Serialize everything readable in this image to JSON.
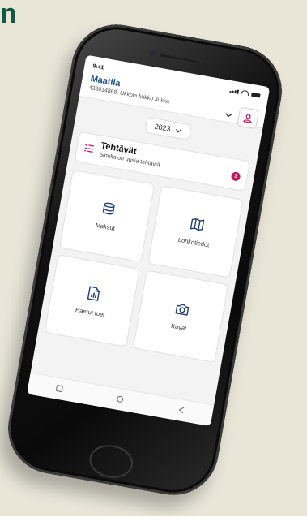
{
  "page_heading_fragment": "n",
  "status_bar": {
    "time": "9:41"
  },
  "header": {
    "title": "Maatila",
    "subtitle": "433014868, Ukkola Mikko Jukka"
  },
  "year_selector": {
    "value": "2023"
  },
  "tasks_card": {
    "title": "Tehtävät",
    "subtitle": "Sinulla on uusia tehtäviä",
    "badge_count": "3"
  },
  "tiles": [
    {
      "label": "Maksut",
      "icon": "coins-icon"
    },
    {
      "label": "Lohkotiedot",
      "icon": "map-icon"
    },
    {
      "label": "Haetut tuet",
      "icon": "document-chart-icon"
    },
    {
      "label": "Kuvat",
      "icon": "camera-icon"
    }
  ],
  "colors": {
    "brand_green": "#0f5a47",
    "title_blue": "#1a4f8a",
    "accent_pink": "#c4135f",
    "icon_navy": "#1f3f6e"
  }
}
